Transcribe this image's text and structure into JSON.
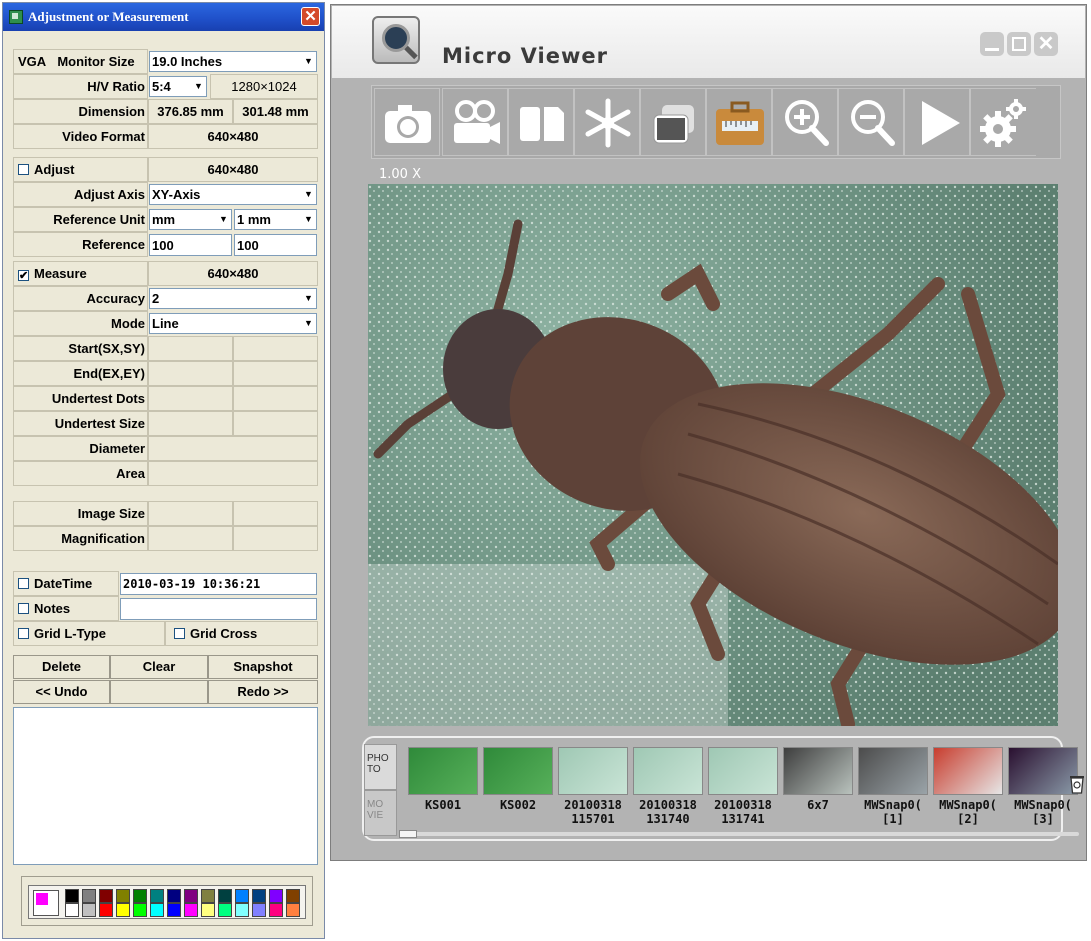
{
  "dialog": {
    "title": "Adjustment or Measurement",
    "close_glyph": "✕",
    "vga_label": "VGA",
    "monitor_size_label": "Monitor Size",
    "monitor_size_value": "19.0 Inches",
    "hv_ratio_label": "H/V Ratio",
    "hv_ratio_value": "5:4",
    "resolution": "1280×1024",
    "dimension_label": "Dimension",
    "dimension_w": "376.85 mm",
    "dimension_h": "301.48 mm",
    "video_format_label": "Video Format",
    "video_format_value": "640×480",
    "adjust_label": "Adjust",
    "adjust_value": "640×480",
    "adjust_axis_label": "Adjust Axis",
    "adjust_axis_value": "XY-Axis",
    "reference_unit_label": "Reference Unit",
    "reference_unit_value": "mm",
    "reference_unit_step": "1 mm",
    "reference_label": "Reference",
    "reference_x": "100",
    "reference_y": "100",
    "measure_label": "Measure",
    "measure_value": "640×480",
    "measure_check": "✔",
    "accuracy_label": "Accuracy",
    "accuracy_value": "2",
    "mode_label": "Mode",
    "mode_value": "Line",
    "start_label": "Start(SX,SY)",
    "end_label": "End(EX,EY)",
    "undertest_dots_label": "Undertest Dots",
    "undertest_size_label": "Undertest Size",
    "diameter_label": "Diameter",
    "area_label": "Area",
    "image_size_label": "Image Size",
    "magnification_label": "Magnification",
    "datetime_label": "DateTime",
    "datetime_value": "2010-03-19  10:36:21",
    "notes_label": "Notes",
    "notes_value": "",
    "grid_ltype_label": "Grid L-Type",
    "grid_cross_label": "Grid Cross",
    "delete_label": "Delete",
    "clear_label": "Clear",
    "snapshot_label": "Snapshot",
    "undo_label": "<< Undo",
    "redo_label": "Redo >>"
  },
  "palette": {
    "current_color": "#ff00ff",
    "row1": [
      "#000000",
      "#808080",
      "#800000",
      "#808000",
      "#008000",
      "#008080",
      "#000080",
      "#800080",
      "#808040",
      "#004040",
      "#0080ff",
      "#004080",
      "#8000ff",
      "#804000"
    ],
    "row2": [
      "#ffffff",
      "#c0c0c0",
      "#ff0000",
      "#ffff00",
      "#00ff00",
      "#00ffff",
      "#0000ff",
      "#ff00ff",
      "#ffff80",
      "#00ff80",
      "#80ffff",
      "#8080ff",
      "#ff0080",
      "#ff8040"
    ]
  },
  "viewer": {
    "title": "Micro Viewer",
    "zoom": "1.00 X",
    "toolbar": [
      "camera-icon",
      "video-camera-icon",
      "split-icon",
      "freeze-icon",
      "layers-icon",
      "ruler-case-icon",
      "zoom-in-icon",
      "zoom-out-icon",
      "play-icon",
      "settings-icon"
    ],
    "tabs": {
      "photo": "PHO TO",
      "movie": "MO VIE"
    },
    "thumbnails": [
      {
        "label1": "KS001",
        "label2": ""
      },
      {
        "label1": "KS002",
        "label2": ""
      },
      {
        "label1": "20100318",
        "label2": "115701"
      },
      {
        "label1": "20100318",
        "label2": "131740"
      },
      {
        "label1": "20100318",
        "label2": "131741"
      },
      {
        "label1": "6x7",
        "label2": ""
      },
      {
        "label1": "MWSnap0(",
        "label2": "[1]"
      },
      {
        "label1": "MWSnap0(",
        "label2": "[2]"
      },
      {
        "label1": "MWSnap0(",
        "label2": "[3]"
      }
    ],
    "accent_active": "#c98a3c"
  }
}
